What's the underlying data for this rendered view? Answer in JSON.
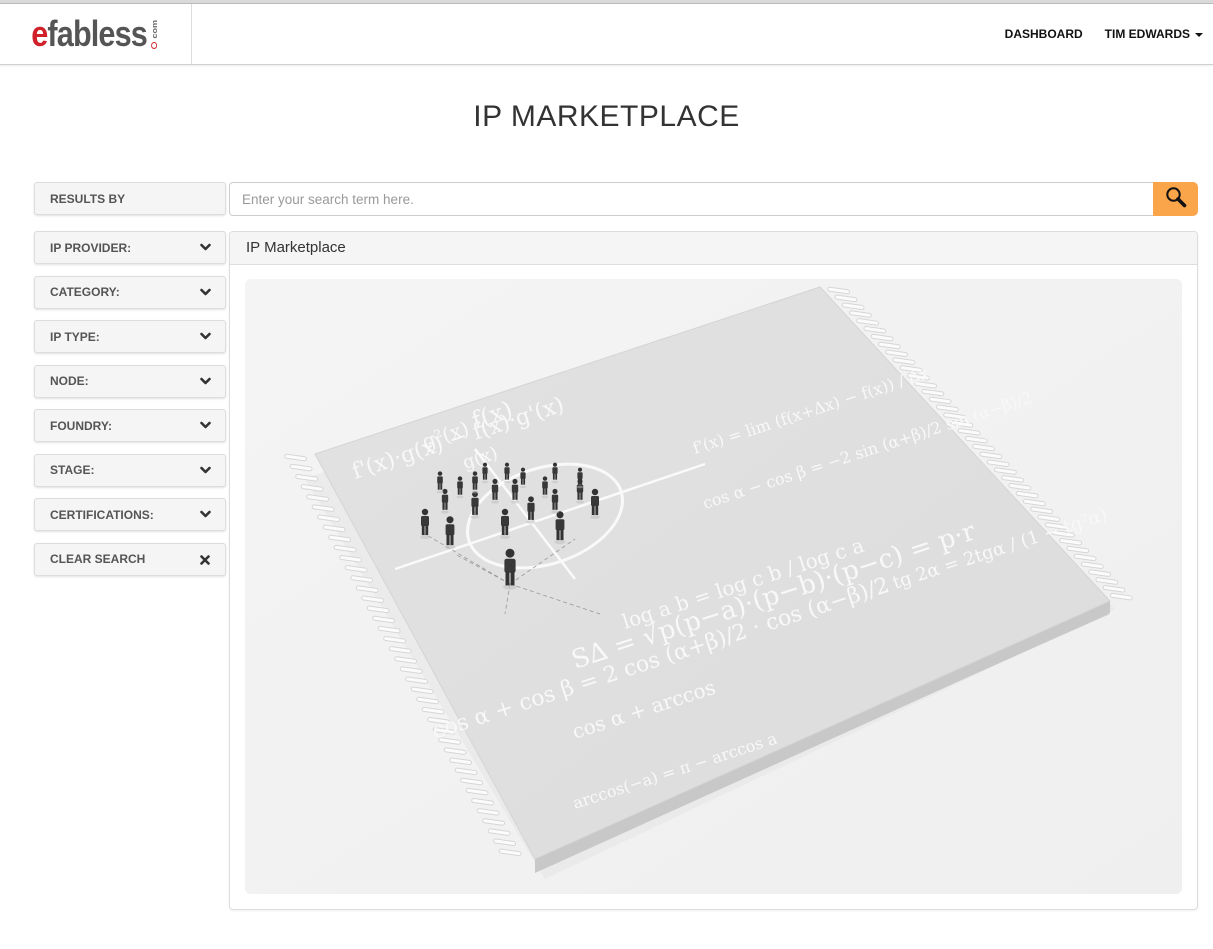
{
  "brand": {
    "logo_main": "fabless",
    "logo_initial": "e",
    "logo_suffix": "com"
  },
  "nav": {
    "dashboard": "DASHBOARD",
    "user": "TIM EDWARDS"
  },
  "page": {
    "title": "IP MARKETPLACE"
  },
  "sidebar": {
    "results_by": "RESULTS BY",
    "filters": [
      {
        "label": "IP PROVIDER:",
        "icon": "chevron-down-icon"
      },
      {
        "label": "CATEGORY:",
        "icon": "chevron-down-icon"
      },
      {
        "label": "IP TYPE:",
        "icon": "chevron-down-icon"
      },
      {
        "label": "NODE:",
        "icon": "chevron-down-icon"
      },
      {
        "label": "FOUNDRY:",
        "icon": "chevron-down-icon"
      },
      {
        "label": "STAGE:",
        "icon": "chevron-down-icon"
      },
      {
        "label": "CERTIFICATIONS:",
        "icon": "chevron-down-icon"
      }
    ],
    "clear": {
      "label": "CLEAR SEARCH",
      "icon": "close-icon"
    }
  },
  "search": {
    "placeholder": "Enter your search term here.",
    "value": "",
    "button_icon": "search-icon",
    "button_color": "#fba54b"
  },
  "panel": {
    "title": "IP Marketplace",
    "hero": {
      "alt": "Chip with mathematical formulas and people figures",
      "formulas": [
        "f'(x)·g(x) − f(x)·g'(x)",
        "g²(x)",
        "f(x)",
        "g(x)",
        "f'(x) = lim (f(x+Δx) − f(x)) / Δx",
        "cos α − cos β = −2 sin (α+β)/2 sin (α−β)/2",
        "S∆ = √p(p−a)·(p−b)·(p−c) = p·r",
        "log a b = log c b / log c a",
        "tg 2α = 2tgα / (1 − tg²α)",
        "cos α + cos β = 2 cos (α+β)/2 · cos (α−β)/2",
        "cos α + arccos",
        "arccos(−a) = π − arccos a"
      ]
    }
  },
  "colors": {
    "brand_red": "#d0202a",
    "brand_gray": "#555555",
    "accent_orange": "#fba54b"
  }
}
